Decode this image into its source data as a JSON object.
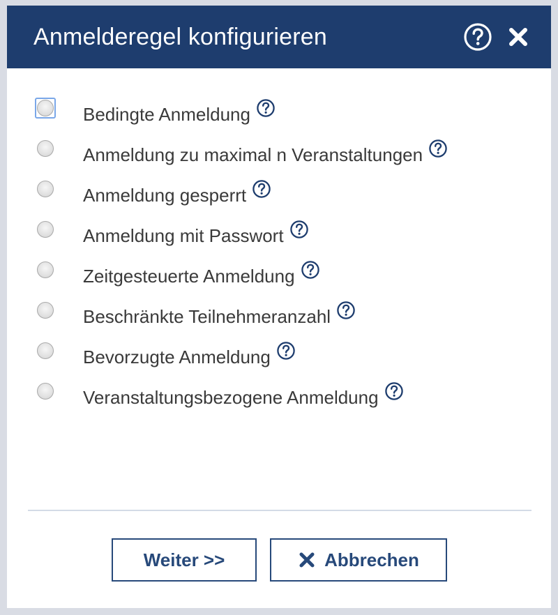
{
  "dialog": {
    "title": "Anmelderegel konfigurieren",
    "help_icon": "question-circle-icon",
    "close_icon": "close-x-icon"
  },
  "options": [
    {
      "label": "Bedingte Anmeldung",
      "checked": false,
      "focused": true
    },
    {
      "label": "Anmeldung zu maximal n Veranstaltungen",
      "checked": false,
      "focused": false
    },
    {
      "label": "Anmeldung gesperrt",
      "checked": false,
      "focused": false
    },
    {
      "label": "Anmeldung mit Passwort",
      "checked": false,
      "focused": false
    },
    {
      "label": "Zeitgesteuerte Anmeldung",
      "checked": false,
      "focused": false
    },
    {
      "label": "Beschränkte Teilnehmeranzahl",
      "checked": false,
      "focused": false
    },
    {
      "label": "Bevorzugte Anmeldung",
      "checked": false,
      "focused": false
    },
    {
      "label": "Veranstaltungsbezogene Anmeldung",
      "checked": false,
      "focused": false
    }
  ],
  "buttons": {
    "next_label": "Weiter >>",
    "cancel_label": "Abbrechen"
  },
  "colors": {
    "header_bg": "#1e3d6e",
    "accent": "#27497a",
    "help_icon": "#1e3d6e"
  }
}
